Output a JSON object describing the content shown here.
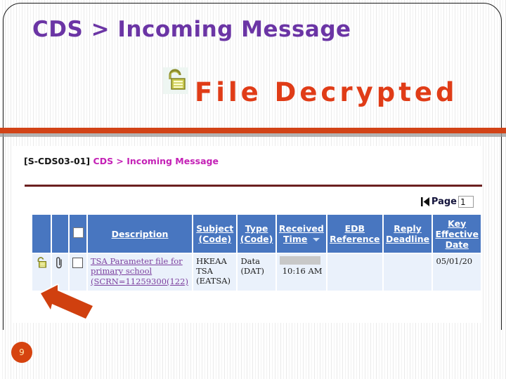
{
  "slide": {
    "title": "CDS > Incoming Message",
    "banner_text": "File Decrypted",
    "lock_icon": "open-padlock-icon",
    "slide_number": "9",
    "accent_purple": "#6b35a5",
    "accent_red": "#e03c17",
    "divider_color": "#d24317"
  },
  "screenshot": {
    "header_code": "[S-CDS03-01]",
    "header_path": "CDS > Incoming Message",
    "pager": {
      "first_page_icon": "first-page-icon",
      "label": "Page",
      "value": "1"
    },
    "table": {
      "headers": {
        "lock": "",
        "attachment": "",
        "select_all": "",
        "description": "Description",
        "subject": "Subject (Code)",
        "type_line1": "Type",
        "type_line2": "(Code)",
        "received_line1": "Received",
        "received_line2": "Time",
        "received_sort": "sort-descending-icon",
        "edb_line1": "EDB",
        "edb_line2": "Reference",
        "reply_line1": "Reply",
        "reply_line2": "Deadline",
        "key_line1": "Key",
        "key_line2": "Effective",
        "key_line3": "Date"
      },
      "rows": [
        {
          "lock_icon": "open-padlock-icon",
          "attachment_icon": "paperclip-icon",
          "checkbox": "row-checkbox",
          "description_line1": "TSA Parameter file for",
          "description_line2": "primary school",
          "description_line3": "(SCRN=11259300(122)",
          "subject_line1": "HKEAA TSA",
          "subject_line2": "(EATSA)",
          "type_line1": "Data",
          "type_line2": "(DAT)",
          "received_date": "",
          "received_time": "10:16 AM",
          "edb_reference": "",
          "reply_deadline": "",
          "key_effective_date": "05/01/20"
        }
      ]
    }
  },
  "annotation": {
    "arrow": "red-arrow-icon"
  }
}
